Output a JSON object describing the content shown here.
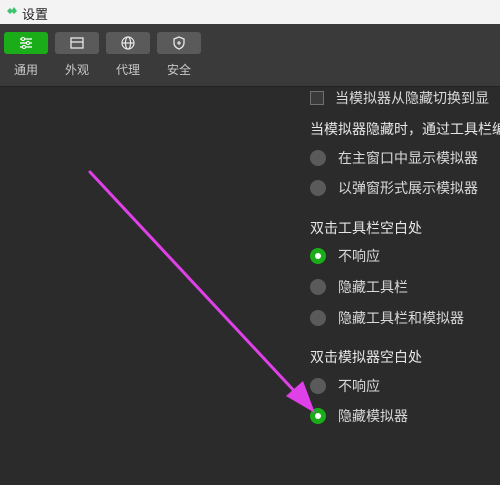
{
  "window": {
    "title": "设置",
    "icon": "wechat-devtools-icon"
  },
  "toolbar": {
    "items": [
      {
        "label": "通用",
        "icon": "sliders-icon",
        "active": true
      },
      {
        "label": "外观",
        "icon": "layout-icon",
        "active": false
      },
      {
        "label": "代理",
        "icon": "globe-icon",
        "active": false
      },
      {
        "label": "安全",
        "icon": "shield-icon",
        "active": false
      }
    ]
  },
  "settings": {
    "switch_checkbox_label": "当模拟器从隐藏切换到显",
    "hide_title": "当模拟器隐藏时，通过工具栏编",
    "hide_options": [
      "在主窗口中显示模拟器",
      "以弹窗形式展示模拟器"
    ],
    "toolbar_dblclick_title": "双击工具栏空白处",
    "toolbar_dblclick_options": [
      "不响应",
      "隐藏工具栏",
      "隐藏工具栏和模拟器"
    ],
    "simulator_dblclick_title": "双击模拟器空白处",
    "simulator_dblclick_options": [
      "不响应",
      "隐藏模拟器"
    ]
  },
  "colors": {
    "accent": "#1aad19",
    "annotation_arrow": "#e040e8",
    "background": "#2b2b2b"
  }
}
